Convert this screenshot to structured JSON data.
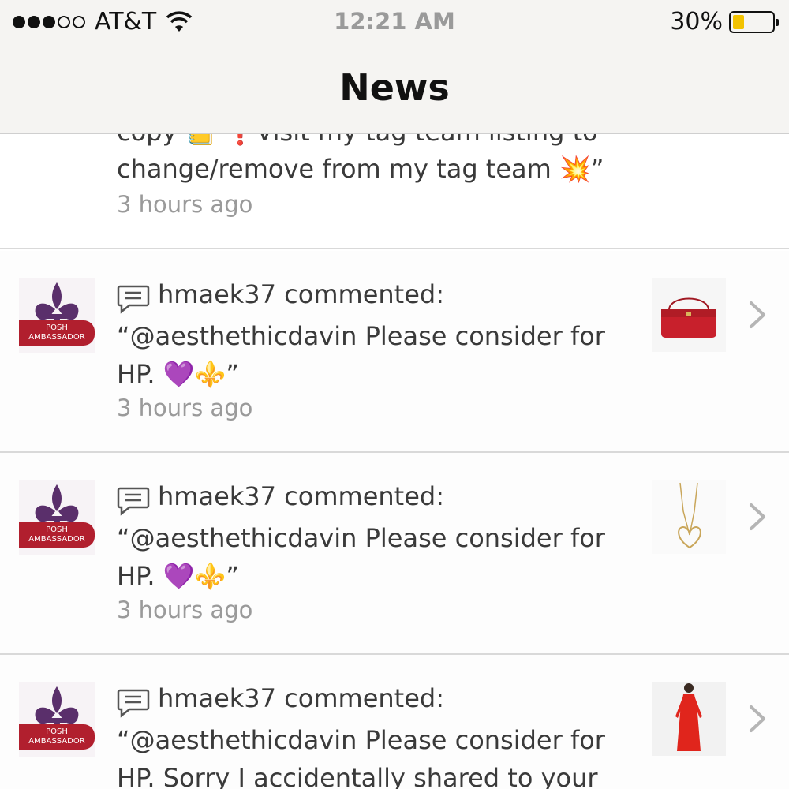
{
  "status_bar": {
    "carrier": "AT&T",
    "time": "12:21 AM",
    "battery_percent_label": "30%",
    "battery_level": 0.3,
    "signal_bars": 3,
    "signal_total": 5
  },
  "header": {
    "title": "News"
  },
  "feed": {
    "partial_item": {
      "cut_text": "copy 📒 ❗Visit my tag team listing to",
      "text": "change/remove from my tag team 💥”",
      "time": "3 hours ago"
    },
    "items": [
      {
        "username": "hmaek37",
        "action": "commented:",
        "badge_line1": "POSH",
        "badge_line2": "AMBASSADOR",
        "text": "“@aesthethicdavin Please consider for HP.",
        "emoji_suffix": "💜⚜️”",
        "time": "3 hours ago",
        "thumbnail": "red-handbag"
      },
      {
        "username": "hmaek37",
        "action": "commented:",
        "badge_line1": "POSH",
        "badge_line2": "AMBASSADOR",
        "text": "“@aesthethicdavin Please consider for HP.",
        "emoji_suffix": "💜⚜️”",
        "time": "3 hours ago",
        "thumbnail": "heart-necklace"
      },
      {
        "username": "hmaek37",
        "action": "commented:",
        "badge_line1": "POSH",
        "badge_line2": "AMBASSADOR",
        "text": "“@aesthethicdavin Please consider for HP. Sorry I accidentally shared to your",
        "emoji_suffix": "",
        "time": "",
        "thumbnail": "red-dress"
      }
    ]
  },
  "colors": {
    "badge": "#b11f2e",
    "heart": "#9b4dde",
    "fleur": "#e8b923",
    "battery": "#f2c200",
    "text": "#3a3a3a",
    "muted": "#9a9a9a"
  }
}
